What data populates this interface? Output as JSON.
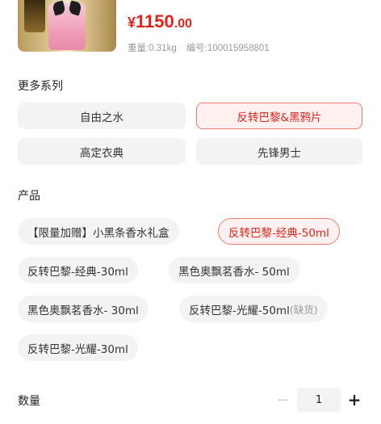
{
  "product": {
    "image_icon": "perfume-bottle-thumbnail",
    "price_symbol": "¥",
    "price_int": "1150",
    "price_dec": ".00",
    "weight": "重量:0.31kg",
    "sku": "编号:100015958801",
    "price_color": "#e2231a"
  },
  "series": {
    "title": "更多系列",
    "options": [
      "自由之水",
      "反转巴黎&黑鸦片",
      "高定衣典",
      "先锋男士"
    ],
    "selected_index": 1
  },
  "products": {
    "title": "产品",
    "options": [
      {
        "label": "【限量加赠】小黑条香水礼盒",
        "note": ""
      },
      {
        "label": "反转巴黎-经典-50ml",
        "note": ""
      },
      {
        "label": "反转巴黎-经典-30ml",
        "note": ""
      },
      {
        "label": "黑色奥飘茗香水- 50ml",
        "note": ""
      },
      {
        "label": "黑色奥飘茗香水- 30ml",
        "note": ""
      },
      {
        "label": "反转巴黎-光耀-50ml",
        "note": "(缺货)"
      },
      {
        "label": "反转巴黎-光耀-30ml",
        "note": ""
      }
    ],
    "selected_index": 1
  },
  "quantity": {
    "label": "数量",
    "minus": "−",
    "value": "1",
    "plus": "+"
  }
}
